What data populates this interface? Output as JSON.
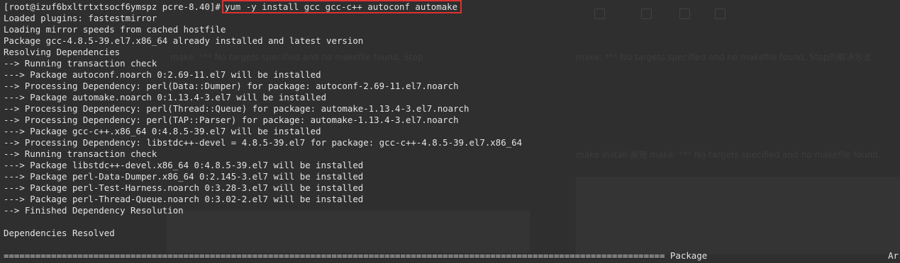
{
  "terminal": {
    "prompt": "[root@izuf6bxltrtxtsocf6ymspz pcre-8.40]#",
    "command": "yum -y install gcc gcc-c++ autoconf automake",
    "output": [
      "Loaded plugins: fastestmirror",
      "Loading mirror speeds from cached hostfile",
      "Package gcc-4.8.5-39.el7.x86_64 already installed and latest version",
      "Resolving Dependencies",
      "--> Running transaction check",
      "---> Package autoconf.noarch 0:2.69-11.el7 will be installed",
      "--> Processing Dependency: perl(Data::Dumper) for package: autoconf-2.69-11.el7.noarch",
      "---> Package automake.noarch 0:1.13.4-3.el7 will be installed",
      "--> Processing Dependency: perl(Thread::Queue) for package: automake-1.13.4-3.el7.noarch",
      "--> Processing Dependency: perl(TAP::Parser) for package: automake-1.13.4-3.el7.noarch",
      "---> Package gcc-c++.x86_64 0:4.8.5-39.el7 will be installed",
      "--> Processing Dependency: libstdc++-devel = 4.8.5-39.el7 for package: gcc-c++-4.8.5-39.el7.x86_64",
      "--> Running transaction check",
      "---> Package libstdc++-devel.x86_64 0:4.8.5-39.el7 will be installed",
      "---> Package perl-Data-Dumper.x86_64 0:2.145-3.el7 will be installed",
      "---> Package perl-Test-Harness.noarch 0:3.28-3.el7 will be installed",
      "---> Package perl-Thread-Queue.noarch 0:3.02-2.el7 will be installed",
      "--> Finished Dependency Resolution",
      "",
      "Dependencies Resolved",
      ""
    ],
    "separator": "============================================================================================================================= Package",
    "bottom_right": "Ar"
  },
  "background_page": {
    "make_line": "make: *** No targets specified and no makefile found.  Stop的解决方法",
    "text_lines": [
      "make: *** No targets specified and no makefile found.  Stop",
      "make install 报错  make: *** No targets specified and no makefile found."
    ]
  },
  "colors": {
    "terminal_bg": "#2f2f2f",
    "terminal_fg": "#e4e4e4",
    "highlight_border": "#e0312d"
  }
}
